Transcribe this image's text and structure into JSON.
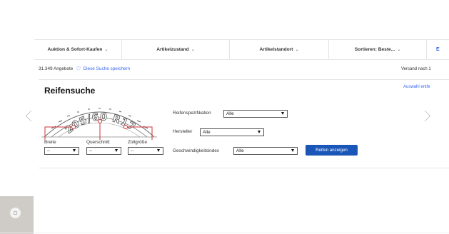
{
  "filter_bar": {
    "items": [
      {
        "label": "Auktion & Sofort-Kaufen"
      },
      {
        "label": "Artikelzustand"
      },
      {
        "label": "Artikelstandort"
      },
      {
        "label": "Sortieren: Beste..."
      }
    ],
    "chevron": "⌄",
    "truncated_label": "E"
  },
  "results": {
    "count": "31.349 Angebote",
    "save_search": "Diese Suche speichern",
    "shipping": "Versand nach 1"
  },
  "tyre_search": {
    "title": "Reifensuche",
    "remove_selection": "Auswahl entfe",
    "tyre_marking": "205/60 R17",
    "width_label": "Breite",
    "width_value": "--",
    "profile_label": "Querschnitt",
    "profile_value": "--",
    "rim_label": "Zollgröße",
    "rim_value": "--",
    "spec_label": "Reifenspezifikation",
    "spec_value": "Alle",
    "maker_label": "Hersteller",
    "maker_value": "Alle",
    "speed_label": "Geschwindigkeitsindex",
    "speed_value": "Alle",
    "submit": "Reifen anzeigen"
  },
  "icons": {
    "heart": "heart-icon",
    "arrows": [
      "chevron-left-icon",
      "chevron-right-icon"
    ],
    "feedback": "feedback-icon"
  },
  "colors": {
    "link": "#3665f3",
    "primary_button": "#1a56b8",
    "tyre_highlight": "#d0353a"
  }
}
